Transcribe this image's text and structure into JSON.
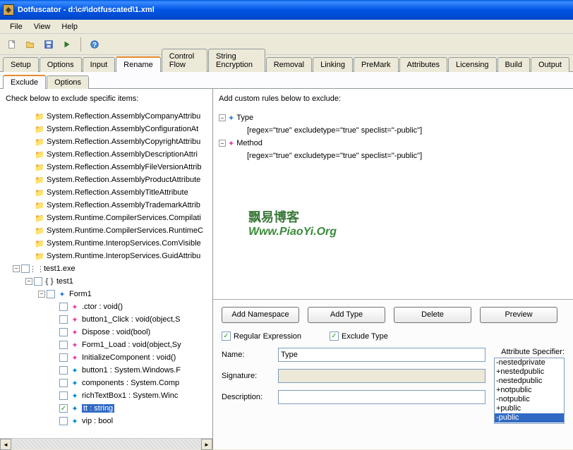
{
  "title": "Dotfuscator - d:\\c#\\dotfuscated\\1.xml",
  "menu": {
    "file": "File",
    "view": "View",
    "help": "Help"
  },
  "tabs": [
    "Setup",
    "Options",
    "Input",
    "Rename",
    "Control Flow",
    "String Encryption",
    "Removal",
    "Linking",
    "PreMark",
    "Attributes",
    "Licensing",
    "Build",
    "Output"
  ],
  "active_tab": "Rename",
  "subtabs": [
    "Exclude",
    "Options"
  ],
  "active_subtab": "Exclude",
  "left": {
    "label": "Check below to exclude specific items:",
    "items": [
      "System.Reflection.AssemblyCompanyAttribu",
      "System.Reflection.AssemblyConfigurationAt",
      "System.Reflection.AssemblyCopyrightAttribu",
      "System.Reflection.AssemblyDescriptionAttri",
      "System.Reflection.AssemblyFileVersionAttrib",
      "System.Reflection.AssemblyProductAttribute",
      "System.Reflection.AssemblyTitleAttribute",
      "System.Reflection.AssemblyTrademarkAttrib",
      "System.Runtime.CompilerServices.Compilati",
      "System.Runtime.CompilerServices.RuntimeC",
      "System.Runtime.InteropServices.ComVisible",
      "System.Runtime.InteropServices.GuidAttribu"
    ],
    "exe": "test1.exe",
    "ns": "test1",
    "cls": "Form1",
    "members": [
      ".ctor : void()",
      "button1_Click : void(object,S",
      "Dispose : void(bool)",
      "Form1_Load : void(object,Sy",
      "InitializeComponent : void()",
      "button1 : System.Windows.F",
      "components : System.Comp",
      "richTextBox1 : System.Winc"
    ],
    "sel": "tt : string",
    "vip": "vip : bool"
  },
  "right": {
    "label": "Add custom rules below to exclude:",
    "rule1": {
      "name": "Type",
      "detail": "[regex=\"true\" excludetype=\"true\" speclist=\"-public\"]"
    },
    "rule2": {
      "name": "Method",
      "detail": "[regex=\"true\" excludetype=\"true\" speclist=\"-public\"]"
    },
    "watermark": {
      "l1": "飘易博客",
      "l2": "Www.PiaoYi.Org"
    },
    "buttons": {
      "ns": "Add Namespace",
      "type": "Add Type",
      "del": "Delete",
      "prev": "Preview"
    },
    "chks": {
      "regex": "Regular Expression",
      "excl": "Exclude Type"
    },
    "form": {
      "name_lbl": "Name:",
      "name_val": "Type",
      "sig_lbl": "Signature:",
      "desc_lbl": "Description:"
    },
    "attr": {
      "lbl": "Attribute Specifier:",
      "opts": [
        "-nestedprivate",
        "+nestedpublic",
        "-nestedpublic",
        "+notpublic",
        "-notpublic",
        "+public",
        "-public"
      ],
      "sel": "-public"
    }
  }
}
